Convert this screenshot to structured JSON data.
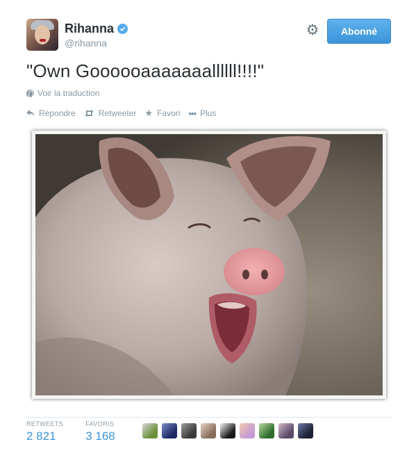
{
  "user": {
    "name": "Rihanna",
    "handle": "@rihanna",
    "follow_label": "Abonné"
  },
  "tweet": {
    "text": "\"Own Goooooaaaaaaallllll!!!!\"",
    "translate_label": "Voir la traduction"
  },
  "actions": [
    {
      "label": "Répondre",
      "icon": "reply-icon"
    },
    {
      "label": "Retweeter",
      "icon": "retweet-icon"
    },
    {
      "label": "Favori",
      "icon": "star-icon"
    },
    {
      "label": "Plus",
      "icon": "more-icon"
    }
  ],
  "stats": {
    "retweets_label": "RETWEETS",
    "retweets_value": "2 821",
    "favorites_label": "FAVORIS",
    "favorites_value": "3 168"
  },
  "favoriters": [
    {
      "color_a": "#6b8f3a",
      "color_b": "#d9d9d9"
    },
    {
      "color_a": "#1d2a64",
      "color_b": "#7b8dc8"
    },
    {
      "color_a": "#3a3a3a",
      "color_b": "#9d9d9d"
    },
    {
      "color_a": "#8a6e5c",
      "color_b": "#e6d3c5"
    },
    {
      "color_a": "#1a1a1a",
      "color_b": "#f2f2f2"
    },
    {
      "color_a": "#c59bd6",
      "color_b": "#f0c9a8"
    },
    {
      "color_a": "#2f6d2f",
      "color_b": "#b4d89a"
    },
    {
      "color_a": "#5b4a6b",
      "color_b": "#d7b9c9"
    },
    {
      "color_a": "#1b2033",
      "color_b": "#6c7aa6"
    }
  ],
  "colors": {
    "accent": "#3b94d9",
    "verified": "#55acee",
    "muted": "#8899a6"
  }
}
